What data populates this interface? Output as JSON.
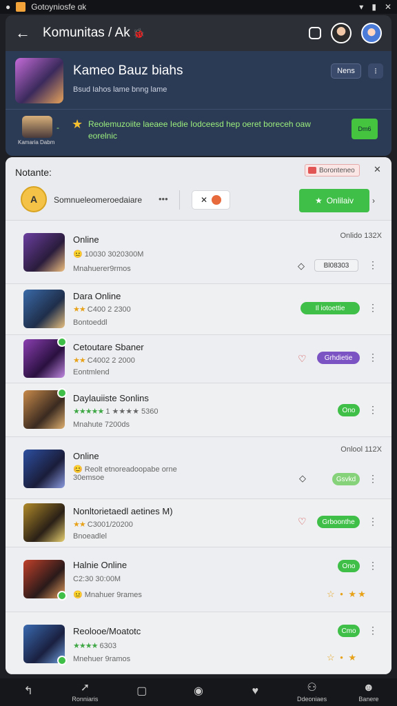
{
  "status_bar": {
    "title": "Gotoyniosfe ɑk",
    "icons": [
      "wifi-icon",
      "battery-icon",
      "close-icon"
    ]
  },
  "header": {
    "title": "Komunitas / Ak",
    "back_icon": "arrow-left-icon"
  },
  "banner": {
    "game_name": "Kameo Bauz biahs",
    "game_subtitle": "Bsud Iahos lame bnng lame",
    "news_label": "Nens",
    "more_label": "⁝",
    "mini_label": "Kamaria Dabm",
    "promo_text": "Reolemuzoiite laeaee Iedie Iodceesd hep oeret boreceh oaw eorelnic",
    "promo_btn": "Dm6",
    "promo_color": "#9cf07d"
  },
  "panel": {
    "title": "Notante:",
    "tag_label": "Boronteneo",
    "org_logo": "A",
    "org_name": "Somnueleomeroedaiare",
    "org_dots": "•••",
    "filter_label": "✕",
    "online_button": "Onlilaiv",
    "accent": "#3fbf47"
  },
  "rows": [
    {
      "name": "Online",
      "rating_icon": "😐",
      "rating_text": "10030 3020300M",
      "meta": "Mnahuerer9rmos",
      "right_text": "Onlido 132X",
      "action_label": "Bl08303",
      "pill_type": "outline"
    },
    {
      "name": "Dara Online",
      "rating_stars": "★★",
      "rating_text": "C400 2 2300",
      "meta": "Bontoeddl",
      "pill_label": "Il iotoettie",
      "pill_type": "green"
    },
    {
      "name": "Cetoutare Sbaner",
      "rating_stars": "★★",
      "rating_text": "C4002 2 2000",
      "meta": "Eontmlend",
      "pill_label": "Grhdietie",
      "pill_type": "purple"
    },
    {
      "name": "Daylauiiste Sonlins",
      "rating_stars": "★★★★★",
      "rating_text": "1 ★★★★ 5360",
      "meta": "Mnahute 7200ds",
      "pill_label": "Ono",
      "pill_type": "green"
    },
    {
      "name": "Online",
      "rating_icon": "😊",
      "rating_text": "Reolt etnoreadoopabe orne 30emsoe",
      "meta": "",
      "right_text": "Onlool 112X",
      "pill_label": "Gsvkd",
      "pill_type": "light-green"
    },
    {
      "name": "Nonltorietaedl aetines M)",
      "rating_stars": "★★",
      "rating_text": "C3001/20200",
      "meta": "Bnoeadlel",
      "pill_label": "Grboonthe",
      "pill_type": "green"
    },
    {
      "name": "Halnie Online",
      "rating_icon": "😐",
      "rating_text": "C2:30 30:00M",
      "meta": "Mnahuer 9rames",
      "pill_label": "Ono",
      "pill_type": "green"
    },
    {
      "name": "Reolooe/Moatotc",
      "rating_stars": "★★★★",
      "rating_text": "6303",
      "meta": "Mnehuer 9ramos",
      "pill_label": "Cmo",
      "pill_type": "green"
    }
  ],
  "bottom_nav": [
    {
      "label": "",
      "icon": "back-arrow-icon"
    },
    {
      "label": "Ronniaris",
      "icon": "compass-icon"
    },
    {
      "label": "",
      "icon": "square-icon"
    },
    {
      "label": "",
      "icon": "circle-icon"
    },
    {
      "label": "",
      "icon": "heart-icon"
    },
    {
      "label": "Ddeoniaes",
      "icon": "people-icon"
    },
    {
      "label": "Banere",
      "icon": "profile-icon"
    }
  ]
}
